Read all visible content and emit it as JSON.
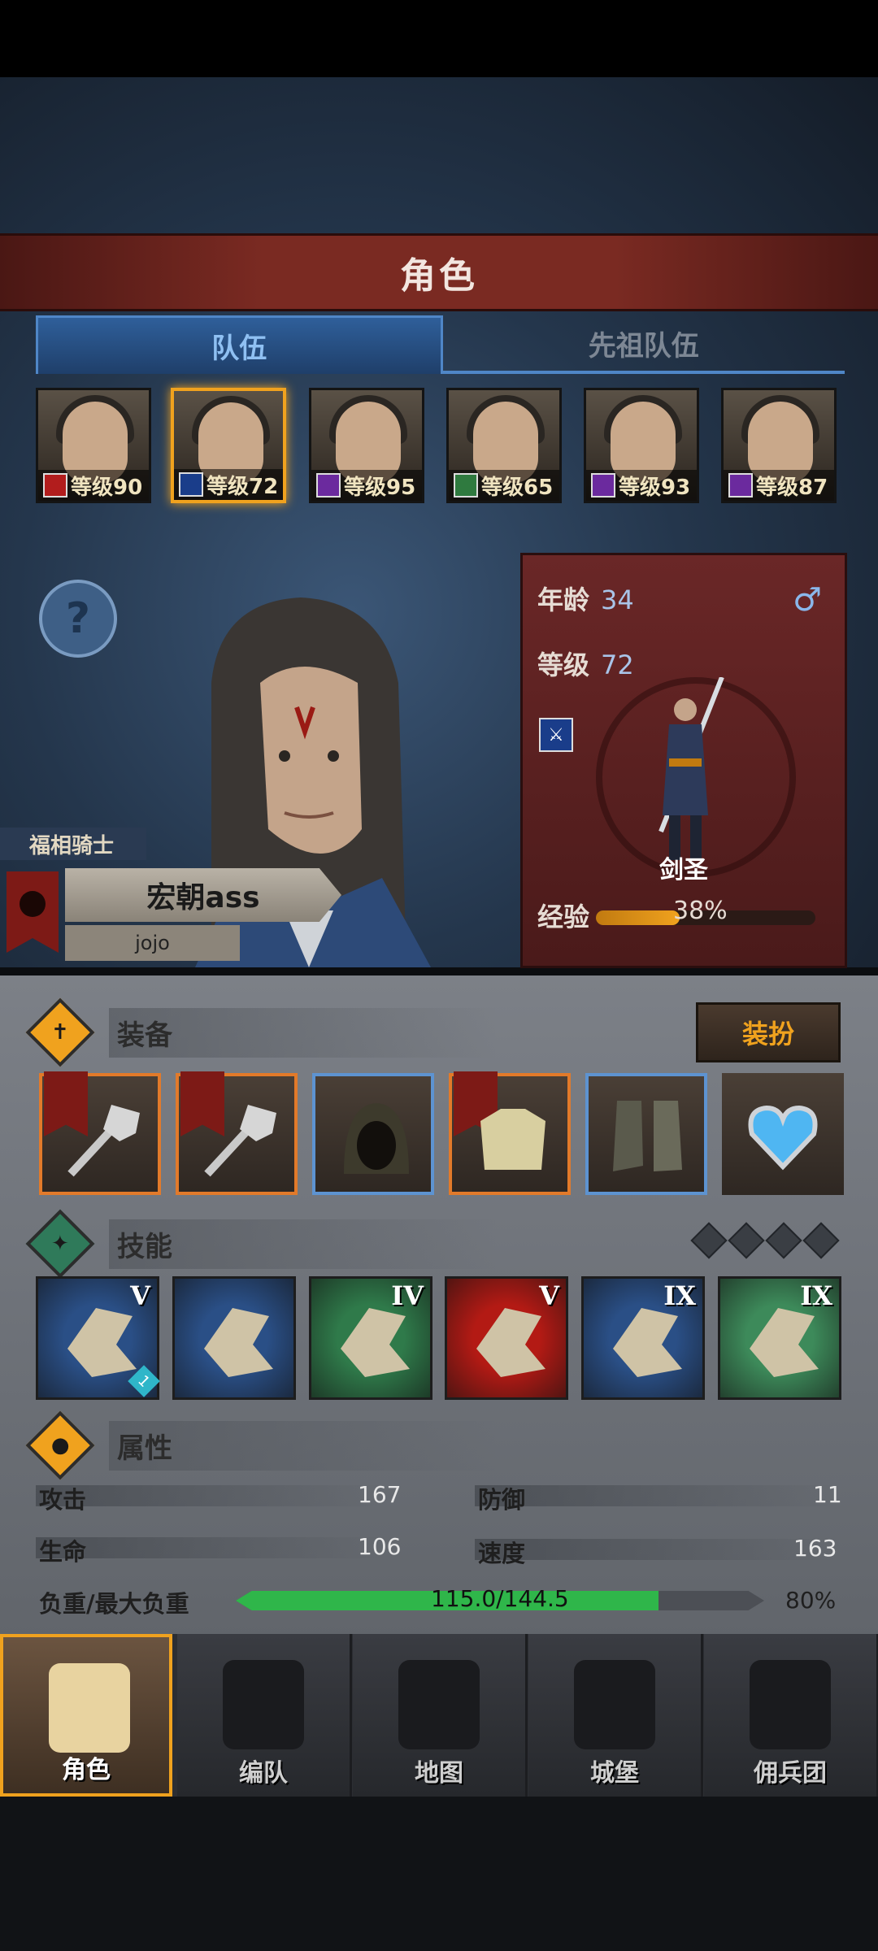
{
  "header": {
    "title": "角色"
  },
  "tabs": [
    {
      "label": "队伍",
      "active": true
    },
    {
      "label": "先祖队伍",
      "active": false
    }
  ],
  "party": [
    {
      "level_text": "等级90",
      "class_icon": "house-icon",
      "class_color": "#b21d1d",
      "selected": false
    },
    {
      "level_text": "等级72",
      "class_icon": "sword-icon",
      "class_color": "#1a3d8a",
      "selected": true
    },
    {
      "level_text": "等级95",
      "class_icon": "staff-icon",
      "class_color": "#6b2a9e",
      "selected": false
    },
    {
      "level_text": "等级65",
      "class_icon": "crossed-swords-icon",
      "class_color": "#2f7a3f",
      "selected": false
    },
    {
      "level_text": "等级93",
      "class_icon": "staff-icon",
      "class_color": "#6b2a9e",
      "selected": false
    },
    {
      "level_text": "等级87",
      "class_icon": "staff-icon",
      "class_color": "#6b2a9e",
      "selected": false
    }
  ],
  "character": {
    "title": "福相骑士",
    "name": "宏朝ass",
    "player": "jojo",
    "age_label": "年龄",
    "age": "34",
    "level_label": "等级",
    "level": "72",
    "gender_icon": "male-icon",
    "class_name": "剑圣",
    "exp_label": "经验",
    "exp_percent": "38%",
    "exp_fraction": 0.38
  },
  "equipment": {
    "label": "装备",
    "dress_button": "装扮",
    "slots": [
      {
        "name": "mace-icon",
        "rarity": "orange",
        "flag": true
      },
      {
        "name": "mace-icon",
        "rarity": "orange",
        "flag": true
      },
      {
        "name": "hood-icon",
        "rarity": "blue",
        "flag": false
      },
      {
        "name": "armor-icon",
        "rarity": "orange",
        "flag": true
      },
      {
        "name": "boots-icon",
        "rarity": "blue",
        "flag": false
      },
      {
        "name": "heart-amulet-icon",
        "rarity": "none",
        "flag": false
      }
    ]
  },
  "skills": {
    "label": "技能",
    "items": [
      {
        "rank": "V",
        "color": "#2a4f86",
        "badge": "1"
      },
      {
        "rank": "",
        "color": "#2a4f86",
        "badge": ""
      },
      {
        "rank": "IV",
        "color": "#2f7a4a",
        "badge": ""
      },
      {
        "rank": "V",
        "color": "#b31a14",
        "badge": ""
      },
      {
        "rank": "IX",
        "color": "#2a4f86",
        "badge": ""
      },
      {
        "rank": "IX",
        "color": "#3d8a5a",
        "badge": ""
      }
    ]
  },
  "attributes": {
    "label": "属性",
    "attack_label": "攻击",
    "attack": "167",
    "defense_label": "防御",
    "defense": "11",
    "hp_label": "生命",
    "hp": "106",
    "speed_label": "速度",
    "speed": "163",
    "load_label": "负重/最大负重",
    "load": "115.0/144.5",
    "load_percent": "80%",
    "load_fraction": 0.8
  },
  "nav": [
    {
      "label": "角色",
      "active": true
    },
    {
      "label": "编队",
      "active": false
    },
    {
      "label": "地图",
      "active": false
    },
    {
      "label": "城堡",
      "active": false
    },
    {
      "label": "佣兵团",
      "active": false
    }
  ]
}
